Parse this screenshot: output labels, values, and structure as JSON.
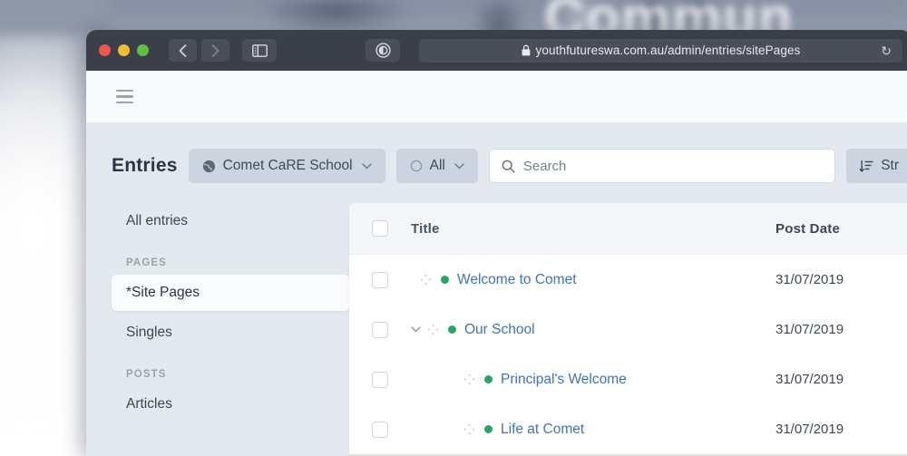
{
  "backdrop": {
    "photo_text": "Commun"
  },
  "browser": {
    "url": "youthfutureswa.com.au/admin/entries/sitePages",
    "lock_icon": "lock-icon",
    "reload_icon": "reload-icon",
    "back_icon": "chevron-left-icon",
    "forward_icon": "chevron-right-icon",
    "sidebar_toggle_icon": "sidebar-toggle-icon",
    "reader_icon": "reader-view-icon",
    "traffic": {
      "close": "close-window-button",
      "minimize": "minimize-window-button",
      "zoom": "zoom-window-button"
    }
  },
  "appbar": {
    "menu_icon": "hamburger-menu-icon"
  },
  "toolbar": {
    "title": "Entries",
    "site_filter": {
      "label": "Comet CaRE School",
      "icon": "globe-icon",
      "caret": "⌄"
    },
    "status_filter": {
      "label": "All",
      "icon": "circle-icon",
      "caret": "⌄"
    },
    "search": {
      "placeholder": "Search",
      "value": "",
      "icon": "search-icon"
    },
    "sort_button": {
      "label": "Str",
      "icon": "sort-icon"
    }
  },
  "sidebar": {
    "items": [
      {
        "label": "All entries",
        "type": "item",
        "active": false
      },
      {
        "label": "PAGES",
        "type": "heading"
      },
      {
        "label": "*Site Pages",
        "type": "item",
        "active": true
      },
      {
        "label": "Singles",
        "type": "item",
        "active": false
      },
      {
        "label": "POSTS",
        "type": "heading"
      },
      {
        "label": "Articles",
        "type": "item",
        "active": false
      }
    ]
  },
  "table": {
    "columns": {
      "title": "Title",
      "post_date": "Post Date"
    },
    "select_all_checkbox": false,
    "rows": [
      {
        "title": "Welcome to Comet",
        "post_date": "31/07/2019",
        "level": 0,
        "status": "live",
        "expandable": false,
        "checked": false
      },
      {
        "title": "Our School",
        "post_date": "31/07/2019",
        "level": 0,
        "status": "live",
        "expandable": true,
        "checked": false
      },
      {
        "title": "Principal's Welcome",
        "post_date": "31/07/2019",
        "level": 1,
        "status": "live",
        "expandable": false,
        "checked": false
      },
      {
        "title": "Life at Comet",
        "post_date": "31/07/2019",
        "level": 1,
        "status": "live",
        "expandable": false,
        "checked": false
      }
    ]
  },
  "colors": {
    "link": "#3e73b8",
    "status_live": "#27a567",
    "chip_bg": "#ccd4e0",
    "page_bg": "#e4e9f0",
    "titlebar": "#3b3f4a"
  }
}
